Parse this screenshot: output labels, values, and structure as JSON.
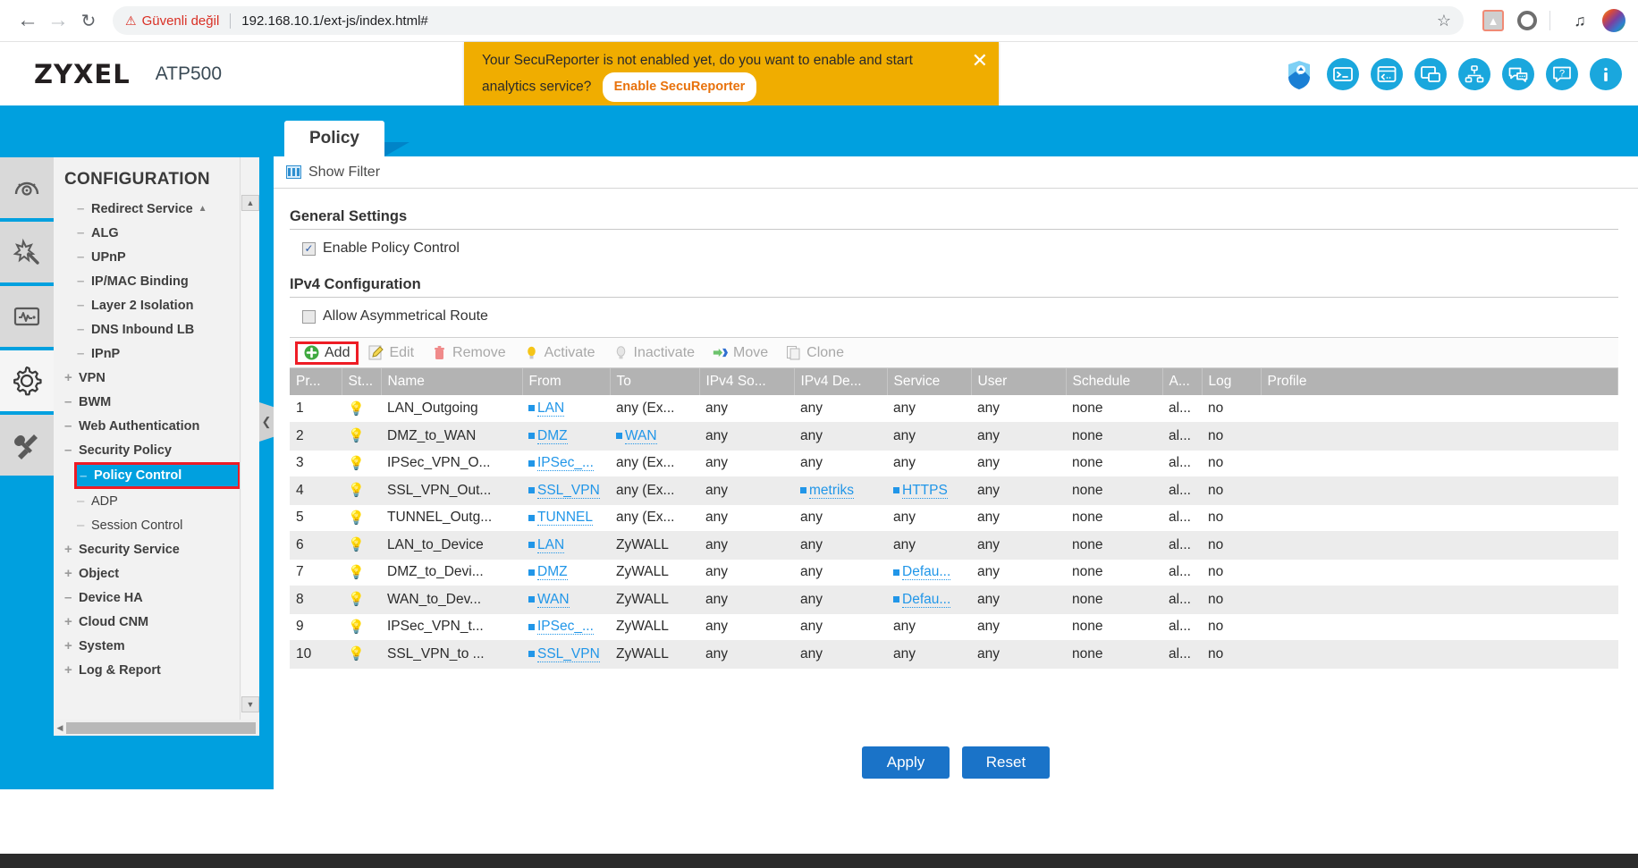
{
  "browser": {
    "back_icon": "back-arrow-icon",
    "forward_icon": "forward-arrow-icon",
    "reload_icon": "reload-icon",
    "security_warning": "Güvenli değil",
    "url": "192.168.10.1/ext-js/index.html#",
    "star_icon": "bookmark-star-icon",
    "extensions": [
      "pdf-extension-icon",
      "opera-extension-icon",
      "media-playlist-icon"
    ],
    "avatar": "user-avatar"
  },
  "header": {
    "logo": "ZYXEL",
    "model": "ATP500",
    "icons": [
      "secureporter-shield-icon",
      "cli-console-icon",
      "web-console-icon",
      "site-map-window-icon",
      "network-topology-icon",
      "chat-support-icon",
      "help-question-icon",
      "about-info-icon"
    ]
  },
  "banner": {
    "message": "Your SecuReporter is not enabled yet, do you want to enable and start analytics service?",
    "button_label": "Enable SecuReporter",
    "close_icon": "close-icon",
    "bg_color": "#f0ad00"
  },
  "rail": {
    "items": [
      {
        "name": "dashboard-icon",
        "active": false
      },
      {
        "name": "wizard-icon",
        "active": false
      },
      {
        "name": "monitor-icon",
        "active": false
      },
      {
        "name": "configuration-gear-icon",
        "active": true
      },
      {
        "name": "maintenance-tools-icon",
        "active": false
      }
    ]
  },
  "sidebar": {
    "title": "CONFIGURATION",
    "scroll_up_icon": "scroll-up-arrow",
    "scroll_down_icon": "scroll-down-arrow",
    "hscroll_left_icon": "scroll-left-arrow",
    "collapse_icon": "collapse-sidebar-chevron",
    "items": [
      {
        "label": "Redirect Service",
        "toggle": "–",
        "level": 2,
        "caret": "▲",
        "selected": false
      },
      {
        "label": "ALG",
        "toggle": "–",
        "level": 2,
        "selected": false
      },
      {
        "label": "UPnP",
        "toggle": "–",
        "level": 2,
        "selected": false
      },
      {
        "label": "IP/MAC Binding",
        "toggle": "–",
        "level": 2,
        "selected": false
      },
      {
        "label": "Layer 2 Isolation",
        "toggle": "–",
        "level": 2,
        "selected": false
      },
      {
        "label": "DNS Inbound LB",
        "toggle": "–",
        "level": 2,
        "selected": false
      },
      {
        "label": "IPnP",
        "toggle": "–",
        "level": 2,
        "selected": false
      },
      {
        "label": "VPN",
        "toggle": "+",
        "level": 1,
        "selected": false
      },
      {
        "label": "BWM",
        "toggle": "–",
        "level": 1,
        "selected": false
      },
      {
        "label": "Web Authentication",
        "toggle": "–",
        "level": 1,
        "selected": false
      },
      {
        "label": "Security Policy",
        "toggle": "–",
        "level": 1,
        "selected": false
      },
      {
        "label": "Policy Control",
        "toggle": "–",
        "level": 2,
        "selected": true
      },
      {
        "label": "ADP",
        "toggle": "–",
        "level": 2,
        "plain": true,
        "selected": false
      },
      {
        "label": "Session Control",
        "toggle": "–",
        "level": 2,
        "plain": true,
        "selected": false
      },
      {
        "label": "Security Service",
        "toggle": "+",
        "level": 1,
        "selected": false
      },
      {
        "label": "Object",
        "toggle": "+",
        "level": 1,
        "selected": false
      },
      {
        "label": "Device HA",
        "toggle": "–",
        "level": 1,
        "selected": false
      },
      {
        "label": "Cloud CNM",
        "toggle": "+",
        "level": 1,
        "selected": false
      },
      {
        "label": "System",
        "toggle": "+",
        "level": 1,
        "selected": false
      },
      {
        "label": "Log & Report",
        "toggle": "+",
        "level": 1,
        "selected": false
      }
    ]
  },
  "main": {
    "tab_label": "Policy",
    "filter_label": "Show Filter",
    "filter_icon": "filter-grid-icon",
    "general_settings_title": "General Settings",
    "enable_policy_control_label": "Enable Policy Control",
    "enable_policy_control_checked": true,
    "ipv4_config_title": "IPv4 Configuration",
    "allow_asymmetrical_route_label": "Allow Asymmetrical Route",
    "allow_asymmetrical_route_checked": false,
    "toolbar": [
      {
        "label": "Add",
        "icon": "add-plus-icon",
        "enabled": true,
        "highlight": true
      },
      {
        "label": "Edit",
        "icon": "edit-pencil-icon",
        "enabled": false
      },
      {
        "label": "Remove",
        "icon": "remove-trash-icon",
        "enabled": false
      },
      {
        "label": "Activate",
        "icon": "activate-bulb-on-icon",
        "enabled": false
      },
      {
        "label": "Inactivate",
        "icon": "inactivate-bulb-off-icon",
        "enabled": false
      },
      {
        "label": "Move",
        "icon": "move-arrow-icon",
        "enabled": false
      },
      {
        "label": "Clone",
        "icon": "clone-page-icon",
        "enabled": false
      }
    ],
    "apply_label": "Apply",
    "reset_label": "Reset"
  },
  "table": {
    "columns": [
      "Pr...",
      "St...",
      "Name",
      "From",
      "To",
      "IPv4 So...",
      "IPv4 De...",
      "Service",
      "User",
      "Schedule",
      "A...",
      "Log",
      "Profile"
    ],
    "rows": [
      {
        "priority": "1",
        "status": "bulb-on",
        "name": "LAN_Outgoing",
        "from": "LAN",
        "from_link": true,
        "to": "any (Ex...",
        "to_link": false,
        "src": "any",
        "dst": "any",
        "service": "any",
        "service_link": false,
        "user": "any",
        "schedule": "none",
        "action": "al...",
        "log": "no",
        "profile": ""
      },
      {
        "priority": "2",
        "status": "bulb-on",
        "name": "DMZ_to_WAN",
        "from": "DMZ",
        "from_link": true,
        "to": "WAN",
        "to_link": true,
        "src": "any",
        "dst": "any",
        "service": "any",
        "service_link": false,
        "user": "any",
        "schedule": "none",
        "action": "al...",
        "log": "no",
        "profile": ""
      },
      {
        "priority": "3",
        "status": "bulb-on",
        "name": "IPSec_VPN_O...",
        "from": "IPSec_...",
        "from_link": true,
        "to": "any (Ex...",
        "to_link": false,
        "src": "any",
        "dst": "any",
        "service": "any",
        "service_link": false,
        "user": "any",
        "schedule": "none",
        "action": "al...",
        "log": "no",
        "profile": ""
      },
      {
        "priority": "4",
        "status": "bulb-on",
        "name": "SSL_VPN_Out...",
        "from": "SSL_VPN",
        "from_link": true,
        "to": "any (Ex...",
        "to_link": false,
        "src": "any",
        "dst": "metriks",
        "dst_link": true,
        "service": "HTTPS",
        "service_link": true,
        "user": "any",
        "schedule": "none",
        "action": "al...",
        "log": "no",
        "profile": ""
      },
      {
        "priority": "5",
        "status": "bulb-on",
        "name": "TUNNEL_Outg...",
        "from": "TUNNEL",
        "from_link": true,
        "to": "any (Ex...",
        "to_link": false,
        "src": "any",
        "dst": "any",
        "service": "any",
        "service_link": false,
        "user": "any",
        "schedule": "none",
        "action": "al...",
        "log": "no",
        "profile": ""
      },
      {
        "priority": "6",
        "status": "bulb-on",
        "name": "LAN_to_Device",
        "from": "LAN",
        "from_link": true,
        "to": "ZyWALL",
        "to_link": false,
        "src": "any",
        "dst": "any",
        "service": "any",
        "service_link": false,
        "user": "any",
        "schedule": "none",
        "action": "al...",
        "log": "no",
        "profile": ""
      },
      {
        "priority": "7",
        "status": "bulb-on",
        "name": "DMZ_to_Devi...",
        "from": "DMZ",
        "from_link": true,
        "to": "ZyWALL",
        "to_link": false,
        "src": "any",
        "dst": "any",
        "service": "Defau...",
        "service_link": true,
        "user": "any",
        "schedule": "none",
        "action": "al...",
        "log": "no",
        "profile": ""
      },
      {
        "priority": "8",
        "status": "bulb-on",
        "name": "WAN_to_Dev...",
        "from": "WAN",
        "from_link": true,
        "to": "ZyWALL",
        "to_link": false,
        "src": "any",
        "dst": "any",
        "service": "Defau...",
        "service_link": true,
        "user": "any",
        "schedule": "none",
        "action": "al...",
        "log": "no",
        "profile": ""
      },
      {
        "priority": "9",
        "status": "bulb-on",
        "name": "IPSec_VPN_t...",
        "from": "IPSec_...",
        "from_link": true,
        "to": "ZyWALL",
        "to_link": false,
        "src": "any",
        "dst": "any",
        "service": "any",
        "service_link": false,
        "user": "any",
        "schedule": "none",
        "action": "al...",
        "log": "no",
        "profile": ""
      },
      {
        "priority": "10",
        "status": "bulb-on",
        "name": "SSL_VPN_to ...",
        "from": "SSL_VPN",
        "from_link": true,
        "to": "ZyWALL",
        "to_link": false,
        "src": "any",
        "dst": "any",
        "service": "any",
        "service_link": false,
        "user": "any",
        "schedule": "none",
        "action": "al...",
        "log": "no",
        "profile": ""
      }
    ]
  }
}
